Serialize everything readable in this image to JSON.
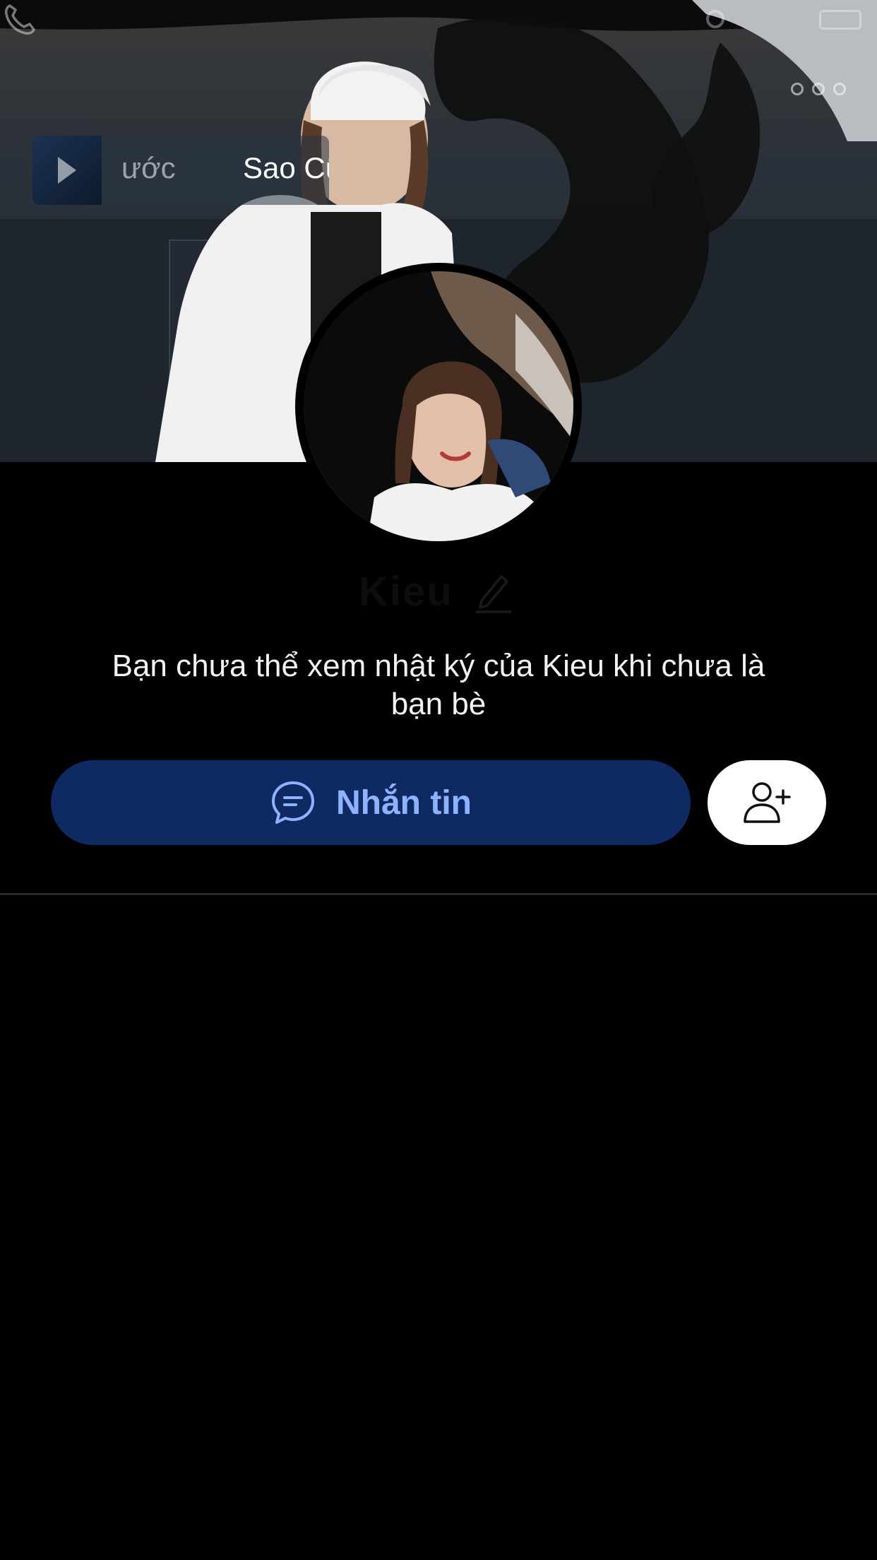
{
  "header": {
    "call_icon": "phone-icon",
    "more_icon": "more-dots-icon"
  },
  "music": {
    "previous_title": "ước",
    "current_title": "Sao Cũ",
    "thumbnail_icon": "play-icon"
  },
  "profile": {
    "name": "Kieu",
    "edit_icon": "pencil-icon"
  },
  "notice": {
    "line1": "Bạn chưa thể xem nhật ký của Kieu khi chưa là",
    "line2": "bạn bè"
  },
  "actions": {
    "message_label": "Nhắn tin",
    "message_icon": "chat-bubble-icon",
    "add_friend_icon": "add-friend-icon"
  },
  "colors": {
    "message_button_bg": "#0f2a63",
    "message_button_text": "#8fb2ff",
    "background": "#000000"
  }
}
